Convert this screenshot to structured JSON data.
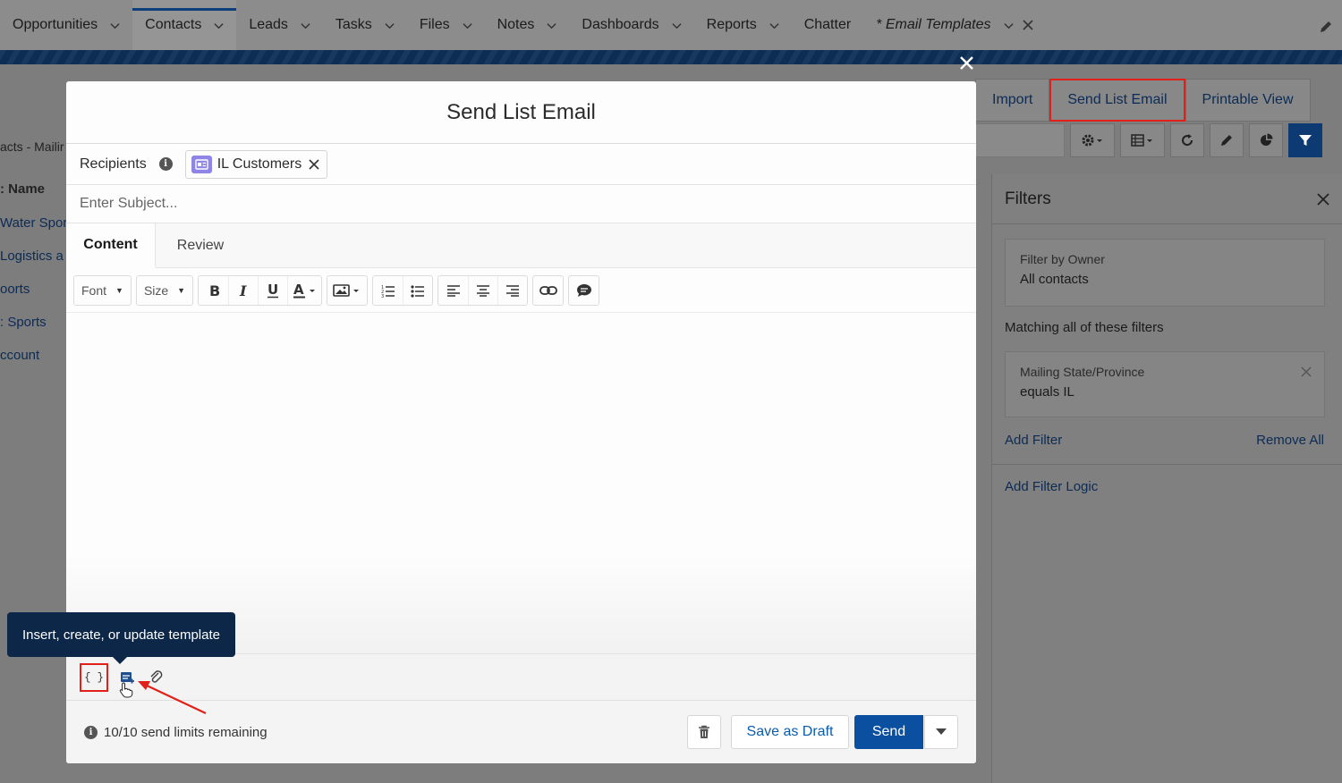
{
  "nav": {
    "items": [
      {
        "label": "Opportunities",
        "chevron": true
      },
      {
        "label": "Contacts",
        "chevron": true,
        "active": true
      },
      {
        "label": "Leads",
        "chevron": true
      },
      {
        "label": "Tasks",
        "chevron": true
      },
      {
        "label": "Files",
        "chevron": true
      },
      {
        "label": "Notes",
        "chevron": true
      },
      {
        "label": "Dashboards",
        "chevron": true
      },
      {
        "label": "Reports",
        "chevron": true
      },
      {
        "label": "Chatter",
        "chevron": false
      }
    ],
    "open_tab": "* Email Templates"
  },
  "list_view": {
    "title_fragment": "acts - Mailir",
    "column_fragment": ": Name",
    "rows": [
      "Water Spor",
      "Logistics a",
      "oorts",
      ": Sports",
      "ccount"
    ],
    "buttons": {
      "import": "Import",
      "send_list_email": "Send List Email",
      "printable_view": "Printable View"
    }
  },
  "filters": {
    "title": "Filters",
    "owner_label": "Filter by Owner",
    "owner_value": "All contacts",
    "matching": "Matching all of these filters",
    "condition_field": "Mailing State/Province",
    "condition_value": "equals  IL",
    "add_filter": "Add Filter",
    "remove_all": "Remove All",
    "add_filter_logic": "Add Filter Logic"
  },
  "modal": {
    "title": "Send List Email",
    "recipients_label": "Recipients",
    "recipient_pill": "IL Customers",
    "subject": {
      "value": "",
      "placeholder": "Enter Subject..."
    },
    "tabs": [
      "Content",
      "Review"
    ],
    "active_tab": "Content",
    "toolbar": {
      "font": "Font",
      "size": "Size"
    },
    "tooltip": "Insert, create, or update template",
    "merge_label": "{ }",
    "send_limits": "10/10 send limits remaining",
    "save_draft": "Save as Draft",
    "send": "Send"
  },
  "colors": {
    "brand_blue": "#0b4fa0",
    "highlight_red": "#e2201a",
    "tooltip_bg": "#0c2747"
  }
}
